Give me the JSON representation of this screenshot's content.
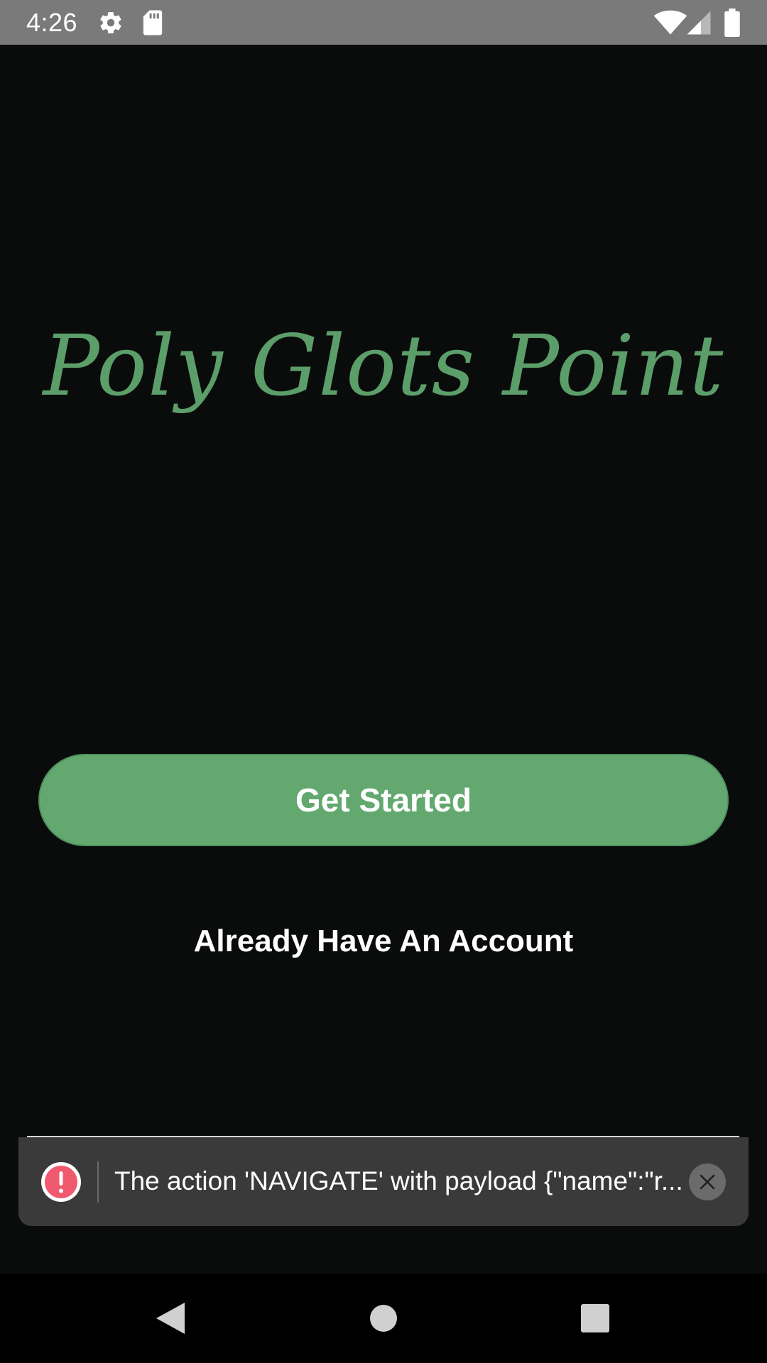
{
  "status_bar": {
    "time": "4:26",
    "icons": [
      "gear-icon",
      "sd-card-icon",
      "wifi-icon",
      "signal-icon",
      "battery-icon"
    ]
  },
  "main": {
    "app_title": "Poly Glots Point",
    "get_started_label": "Get Started",
    "account_link_label": "Already Have An Account"
  },
  "error_toast": {
    "icon": "alert-icon",
    "message": "The action 'NAVIGATE' with payload {\"name\":\"r...",
    "close_icon": "close-icon"
  },
  "nav_bar": {
    "buttons": [
      "back-icon",
      "home-icon",
      "recent-apps-icon"
    ]
  },
  "colors": {
    "background": "#0a0c0c",
    "accent_green": "#63a96f",
    "title_green": "#5c9e69",
    "status_bar": "#7a7a7a",
    "toast_background": "#3a3a3a",
    "error_red": "#ef5a6f"
  }
}
